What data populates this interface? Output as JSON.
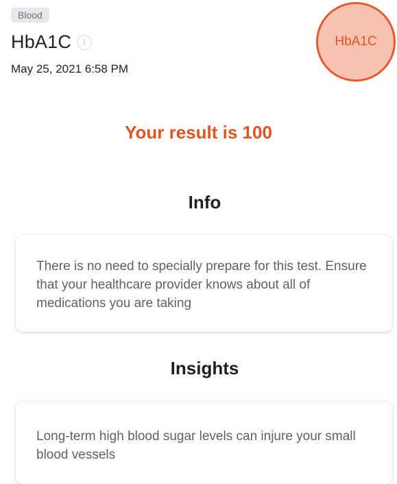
{
  "header": {
    "category": "Blood",
    "title": "HbA1C",
    "info_icon": "info-icon",
    "timestamp": "May 25, 2021 6:58 PM",
    "badge_label": "HbA1C"
  },
  "result": {
    "text": "Your result is 100"
  },
  "info": {
    "heading": "Info",
    "body": "There is no need to specially prepare for this test. Ensure that your healthcare provider knows about all of medications you are taking"
  },
  "insights": {
    "heading": "Insights",
    "body": "Long-term high blood sugar levels can injure your small blood vessels"
  },
  "colors": {
    "accent": "#e0541f",
    "badge_fill": "#f8c2b1",
    "badge_ring": "#e35b2c",
    "chip_bg": "#e6e8ec"
  }
}
